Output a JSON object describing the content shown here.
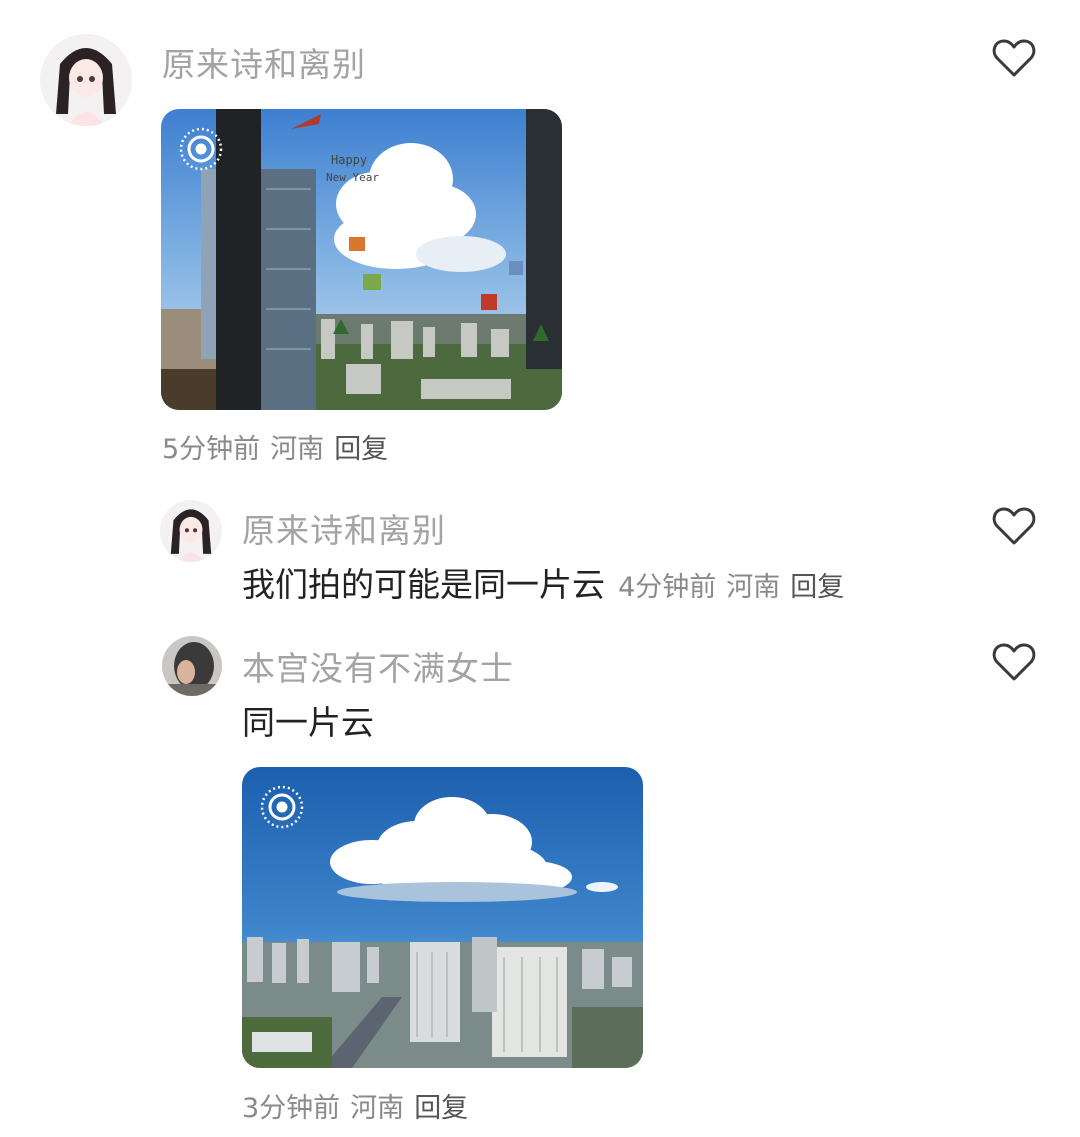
{
  "comments": [
    {
      "username": "原来诗和离别",
      "image": {
        "description": "cloud through office window with Christmas stickers",
        "badge": "live-photo-icon"
      },
      "meta": {
        "time": "5分钟前",
        "location": "河南",
        "reply": "回复"
      }
    },
    {
      "username": "原来诗和离别",
      "text": "我们拍的可能是同一片云",
      "meta": {
        "time": "4分钟前",
        "location": "河南",
        "reply": "回复"
      }
    },
    {
      "username": "本宫没有不满女士",
      "text": "同一片云",
      "image": {
        "description": "large cumulus cloud over city skyline",
        "badge": "live-photo-icon"
      },
      "meta": {
        "time": "3分钟前",
        "location": "河南",
        "reply": "回复"
      }
    }
  ],
  "icons": {
    "like": "heart-outline-icon",
    "live": "live-photo-icon"
  },
  "colors": {
    "username": "#a3a3a3",
    "text": "#222222",
    "meta": "#8a8a8a"
  }
}
